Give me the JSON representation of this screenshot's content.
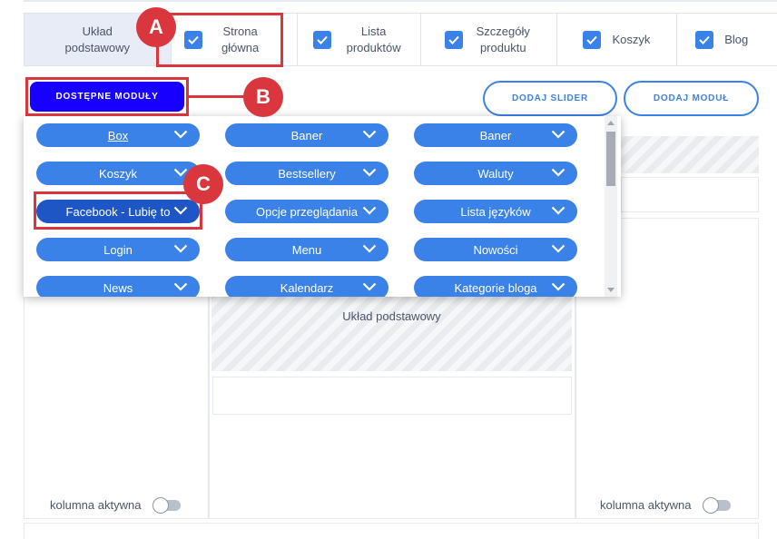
{
  "tabs": [
    {
      "label": "Układ podstawowy",
      "checked": false
    },
    {
      "label": "Strona główna",
      "checked": true
    },
    {
      "label": "Lista produktów",
      "checked": true
    },
    {
      "label": "Szczegóły produktu",
      "checked": true
    },
    {
      "label": "Koszyk",
      "checked": true
    },
    {
      "label": "Blog",
      "checked": true
    }
  ],
  "toolbar": {
    "available_modules": "DOSTĘPNE MODUŁY",
    "add_slider": "DODAJ SLIDER",
    "add_module": "DODAJ MODUŁ"
  },
  "modules": {
    "col1": [
      "Box",
      "Koszyk",
      "Facebook - Lubię to",
      "Login",
      "News"
    ],
    "col2": [
      "Baner",
      "Bestsellery",
      "Opcje przeglądania",
      "Menu",
      "Kalendarz"
    ],
    "col3": [
      "Baner",
      "Waluty",
      "Lista języków",
      "Nowości",
      "Kategorie bloga"
    ]
  },
  "layout": {
    "center_label": "Układ podstawowy",
    "left_column_status": "kolumna aktywna",
    "right_column_status": "kolumna aktywna"
  },
  "annotations": {
    "a": "A",
    "b": "B",
    "c": "C"
  },
  "colors": {
    "accent": "#3b82e8",
    "primary_button": "#1800ff",
    "annotation": "#d9363e"
  }
}
